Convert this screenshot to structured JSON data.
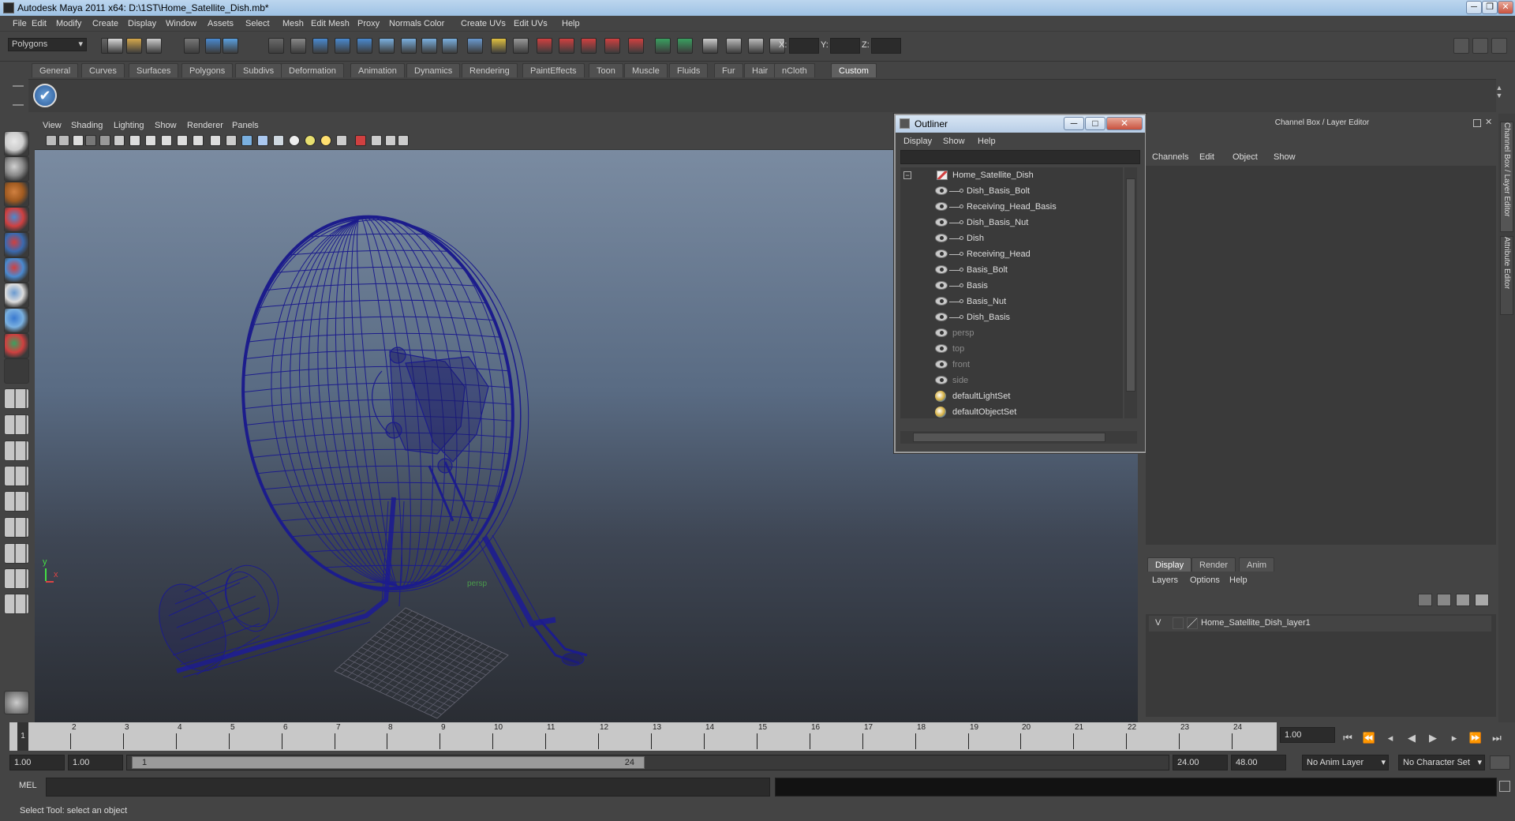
{
  "window": {
    "title": "Autodesk Maya 2011 x64: D:\\1ST\\Home_Satellite_Dish.mb*",
    "minimize": "─",
    "restore": "❐",
    "close": "✕"
  },
  "menubar": [
    "File",
    "Edit",
    "Modify",
    "Create",
    "Display",
    "Window",
    "Assets",
    "Select",
    "Mesh",
    "Edit Mesh",
    "Proxy",
    "Normals",
    "Color",
    "Create UVs",
    "Edit UVs",
    "Help"
  ],
  "statusline": {
    "mode": "Polygons",
    "x_label": "X:",
    "y_label": "Y:",
    "z_label": "Z:"
  },
  "shelf": {
    "tabs": [
      "General",
      "Curves",
      "Surfaces",
      "Polygons",
      "Subdivs",
      "Deformation",
      "Animation",
      "Dynamics",
      "Rendering",
      "PaintEffects",
      "Toon",
      "Muscle",
      "Fluids",
      "Fur",
      "Hair",
      "nCloth",
      "Custom"
    ],
    "active": "Custom"
  },
  "viewport": {
    "menu": [
      "View",
      "Shading",
      "Lighting",
      "Show",
      "Renderer",
      "Panels"
    ],
    "camera_label": "persp",
    "axis_y": "y",
    "axis_x": "x"
  },
  "outliner": {
    "title": "Outliner",
    "menu": [
      "Display",
      "Show",
      "Help"
    ],
    "root": "Home_Satellite_Dish",
    "children": [
      "Dish_Basis_Bolt",
      "Receiving_Head_Basis",
      "Dish_Basis_Nut",
      "Dish",
      "Receiving_Head",
      "Basis_Bolt",
      "Basis",
      "Basis_Nut",
      "Dish_Basis"
    ],
    "cameras": [
      "persp",
      "top",
      "front",
      "side"
    ],
    "sets": [
      "defaultLightSet",
      "defaultObjectSet"
    ]
  },
  "channelbox": {
    "title": "Channel Box / Layer Editor",
    "menu": [
      "Channels",
      "Edit",
      "Object",
      "Show"
    ],
    "layer_tabs": [
      "Display",
      "Render",
      "Anim"
    ],
    "layer_tab_active": "Display",
    "layer_menu": [
      "Layers",
      "Options",
      "Help"
    ],
    "layer_visible": "V",
    "layer_name": "Home_Satellite_Dish_layer1"
  },
  "side_tabs": [
    "Channel Box / Layer Editor",
    "Attribute Editor"
  ],
  "timeslider": {
    "ticks": [
      "1",
      "2",
      "3",
      "4",
      "5",
      "6",
      "7",
      "8",
      "9",
      "10",
      "11",
      "12",
      "13",
      "14",
      "15",
      "16",
      "17",
      "18",
      "19",
      "20",
      "21",
      "22",
      "23",
      "24"
    ],
    "current": "1",
    "current_time": "1.00"
  },
  "range": {
    "start": "1.00",
    "playback_start": "1.00",
    "slider_start": "1",
    "slider_end": "24",
    "playback_end": "24.00",
    "end": "48.00",
    "anim_layer": "No Anim Layer",
    "character_set": "No Character Set"
  },
  "cmdline": {
    "label": "MEL"
  },
  "helpline": "Select Tool: select an object",
  "colors": {
    "wire": "#1c1c8c",
    "ui": "#444444",
    "accent": "#6a8fb8"
  }
}
